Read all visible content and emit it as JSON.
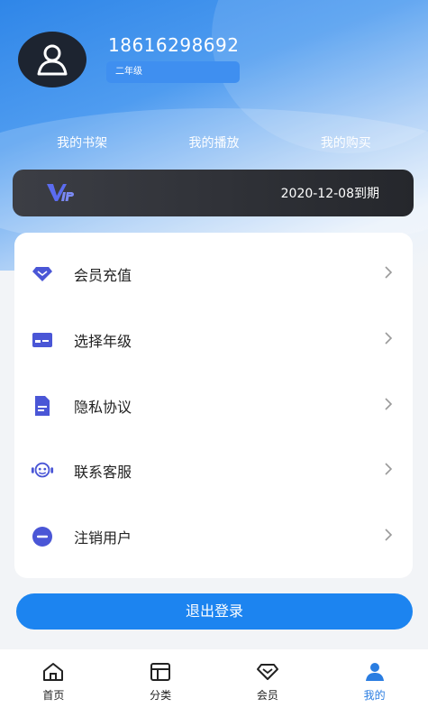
{
  "profile": {
    "phone": "18616298692",
    "grade": "二年级"
  },
  "shortcuts": [
    "我的书架",
    "我的播放",
    "我的购买"
  ],
  "vip": {
    "logo_text": "VIP",
    "expire": "2020-12-08到期"
  },
  "menu": [
    {
      "label": "会员充值",
      "icon": "diamond-icon"
    },
    {
      "label": "选择年级",
      "icon": "id-card-icon"
    },
    {
      "label": "隐私协议",
      "icon": "document-icon"
    },
    {
      "label": "联系客服",
      "icon": "service-robot-icon"
    },
    {
      "label": "注销用户",
      "icon": "minus-circle-icon"
    }
  ],
  "logout_label": "退出登录",
  "tabs": [
    {
      "label": "首页",
      "icon": "home-icon",
      "active": false
    },
    {
      "label": "分类",
      "icon": "category-icon",
      "active": false
    },
    {
      "label": "会员",
      "icon": "diamond-icon",
      "active": false
    },
    {
      "label": "我的",
      "icon": "user-icon",
      "active": true
    }
  ],
  "colors": {
    "accent": "#1c84f0",
    "menu_icon": "#4a56d6",
    "active_tab": "#2a7de1",
    "vip_bar": "#2c2e33"
  }
}
